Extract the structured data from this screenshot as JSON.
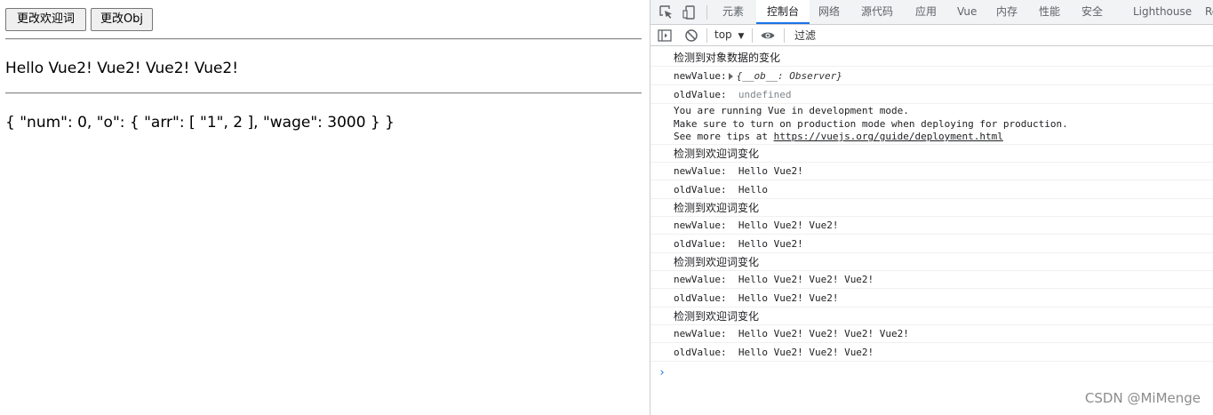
{
  "page": {
    "buttons": {
      "change_greeting": "更改欢迎词",
      "change_obj": "更改Obj"
    },
    "greeting_text": "Hello Vue2! Vue2! Vue2! Vue2!",
    "object_dump": "{ \"num\": 0, \"o\": { \"arr\": [ \"1\", 2 ], \"wage\": 3000 } }"
  },
  "devtools": {
    "tabs": [
      "元素",
      "控制台",
      "网络",
      "源代码",
      "应用",
      "Vue",
      "内存",
      "性能",
      "安全",
      "Lighthouse",
      "Re"
    ],
    "active_tab": "控制台",
    "toolbar": {
      "context": "top",
      "filter_placeholder": "过滤"
    },
    "console": {
      "r1": "检测到对象数据的变化",
      "r2_key": "newValue:",
      "r2_val": "{__ob__: Observer}",
      "r3_key": "oldValue:",
      "r3_val": "undefined",
      "r4_l1": "You are running Vue in development mode.",
      "r4_l2": "Make sure to turn on production mode when deploying for production.",
      "r4_l3_prefix": "See more tips at ",
      "r4_l3_link": "https://vuejs.org/guide/deployment.html",
      "r5": "检测到欢迎词变化",
      "r6_key": "newValue:",
      "r6_val": "Hello Vue2!",
      "r7_key": "oldValue:",
      "r7_val": "Hello",
      "r8": "检测到欢迎词变化",
      "r9_key": "newValue:",
      "r9_val": "Hello Vue2! Vue2!",
      "r10_key": "oldValue:",
      "r10_val": "Hello Vue2!",
      "r11": "检测到欢迎词变化",
      "r12_key": "newValue:",
      "r12_val": "Hello Vue2! Vue2! Vue2!",
      "r13_key": "oldValue:",
      "r13_val": "Hello Vue2! Vue2!",
      "r14": "检测到欢迎词变化",
      "r15_key": "newValue:",
      "r15_val": "Hello Vue2! Vue2! Vue2! Vue2!",
      "r16_key": "oldValue:",
      "r16_val": "Hello Vue2! Vue2! Vue2!",
      "prompt": "›"
    }
  },
  "watermark": "CSDN @MiMenge",
  "colors": {
    "accent": "#1a73e8",
    "tabbar_bg": "#f1f3f4",
    "border": "#cbcdd1"
  },
  "icons": [
    "inspect-icon",
    "device-toggle-icon",
    "sidebar-toggle-icon",
    "clear-console-icon",
    "dropdown-arrow-icon",
    "eye-icon"
  ]
}
